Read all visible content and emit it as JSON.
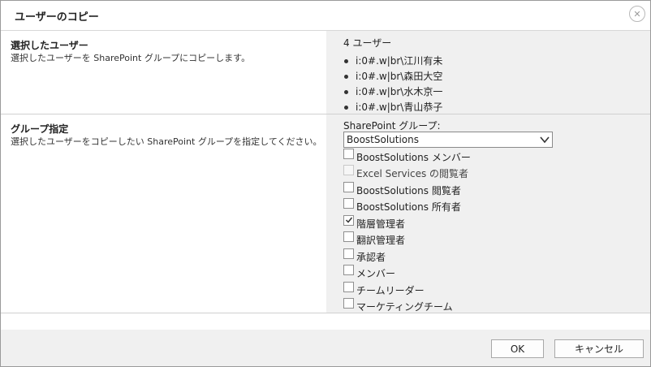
{
  "dialog": {
    "title": "ユーザーのコピー",
    "close_icon": "close-circle-icon"
  },
  "selected_users": {
    "heading": "選択したユーザー",
    "description": "選択したユーザーを SharePoint グループにコピーします。",
    "count_label": "4 ユーザー",
    "users": [
      "i:0#.w|br\\江川有未",
      "i:0#.w|br\\森田大空",
      "i:0#.w|br\\水木京一",
      "i:0#.w|br\\青山恭子"
    ]
  },
  "group_spec": {
    "heading": "グループ指定",
    "description": "選択したユーザーをコピーしたい SharePoint グループを指定してください。",
    "select_label": "SharePoint グループ:",
    "select_value": "BoostSolutions",
    "groups": [
      {
        "label": "BoostSolutions メンバー",
        "checked": false,
        "disabled": false
      },
      {
        "label": "Excel Services の閲覧者",
        "checked": false,
        "disabled": true
      },
      {
        "label": "BoostSolutions 閲覧者",
        "checked": false,
        "disabled": false
      },
      {
        "label": "BoostSolutions 所有者",
        "checked": false,
        "disabled": false
      },
      {
        "label": "階層管理者",
        "checked": true,
        "disabled": false
      },
      {
        "label": "翻訳管理者",
        "checked": false,
        "disabled": false
      },
      {
        "label": "承認者",
        "checked": false,
        "disabled": false
      },
      {
        "label": "メンバー",
        "checked": false,
        "disabled": false
      },
      {
        "label": "チームリーダー",
        "checked": false,
        "disabled": false
      },
      {
        "label": "マーケティングチーム",
        "checked": false,
        "disabled": false
      }
    ]
  },
  "footer": {
    "ok_label": "OK",
    "cancel_label": "キャンセル"
  }
}
